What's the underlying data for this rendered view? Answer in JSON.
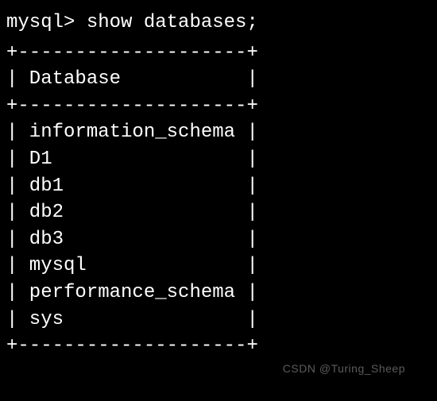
{
  "prompt": "mysql> ",
  "command": "show databases;",
  "table": {
    "border_top": "+--------------------+",
    "header_line": "| Database           |",
    "border_mid": "+--------------------+",
    "rows_raw": [
      "| information_schema |",
      "| D1                 |",
      "| db1                |",
      "| db2                |",
      "| db3                |",
      "| mysql              |",
      "| performance_schema |",
      "| sys                |"
    ],
    "border_bot": "+--------------------+",
    "header": "Database",
    "rows": [
      "information_schema",
      "D1",
      "db1",
      "db2",
      "db3",
      "mysql",
      "performance_schema",
      "sys"
    ]
  },
  "watermark": "CSDN @Turing_Sheep"
}
